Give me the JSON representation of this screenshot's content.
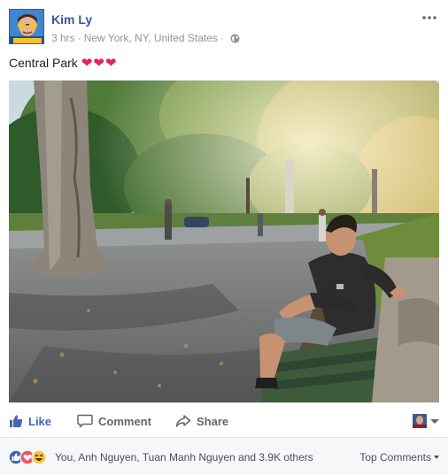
{
  "post": {
    "author": "Kim Ly",
    "time": "3 hrs",
    "location": "New York, NY, United States",
    "privacy_icon": "globe-icon",
    "caption": "Central Park",
    "caption_emoji": "❤❤❤",
    "avatar_badge": "VIỆT NAM CUP"
  },
  "actions": {
    "like": "Like",
    "comment": "Comment",
    "share": "Share"
  },
  "reactions": {
    "types": [
      "like",
      "love",
      "haha"
    ],
    "summary": "You, Anh Nguyen, Tuan Manh Nguyen and 3.9K others",
    "sort": "Top Comments"
  },
  "colors": {
    "link": "#365899",
    "like_blue": "#4267b2",
    "love_red": "#f25268",
    "haha_yellow": "#f7c744",
    "footer_bg": "#f6f7f9"
  }
}
